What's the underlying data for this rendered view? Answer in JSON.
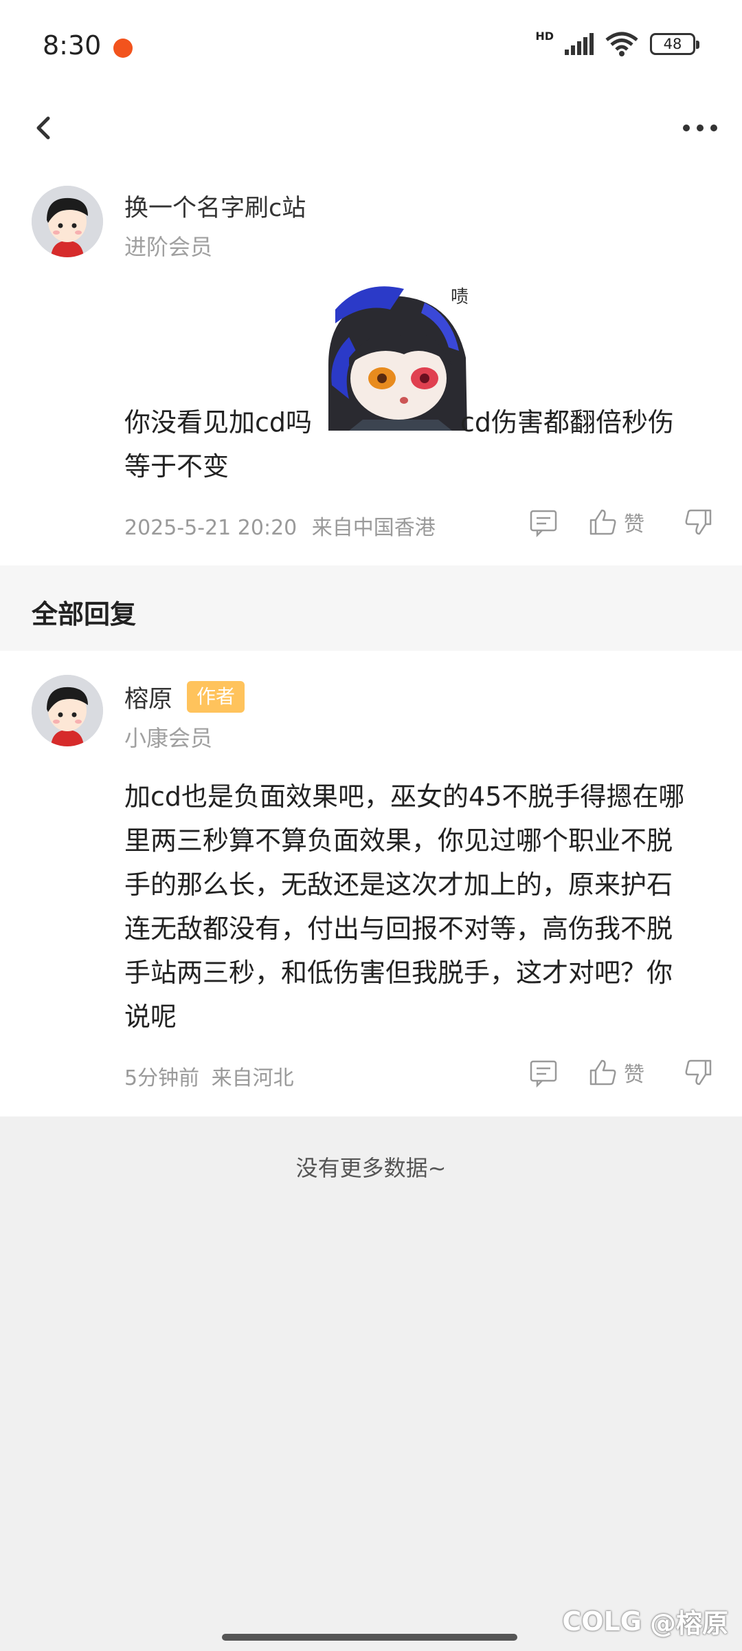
{
  "status": {
    "time": "8:30",
    "network": "HD",
    "wifi_sub": "6",
    "battery": "48"
  },
  "post": {
    "username": "换一个名字刷c站",
    "member_level": "进阶会员",
    "text_before_sticker": "你没看见加cd吗",
    "sticker_caption": "啧",
    "text_after_sticker": "cd伤害都翻倍秒伤",
    "text_line2": "等于不变",
    "timestamp": "2025-5-21 20:20",
    "location": "来自中国香港",
    "like_label": "赞"
  },
  "section_title": "全部回复",
  "reply": {
    "username": "榕原",
    "badge": "作者",
    "member_level": "小康会员",
    "lines": [
      "加cd也是负面效果吧，巫女的45不脱手得摁在哪",
      "里两三秒算不算负面效果，你见过哪个职业不脱",
      "手的那么长，无敌还是这次才加上的，原来护石",
      "连无敌都没有，付出与回报不对等，高伤我不脱",
      "手站两三秒，和低伤害但我脱手，这才对吧？你",
      "说呢"
    ],
    "time": "5分钟前",
    "location": "来自河北",
    "like_label": "赞"
  },
  "no_more": "没有更多数据~",
  "watermark": {
    "logo": "COLG",
    "handle": "@榕原"
  },
  "colors": {
    "badge": "#ffc35c",
    "notification": "#f2531d",
    "sticker_hair": "#2b3ac8"
  }
}
